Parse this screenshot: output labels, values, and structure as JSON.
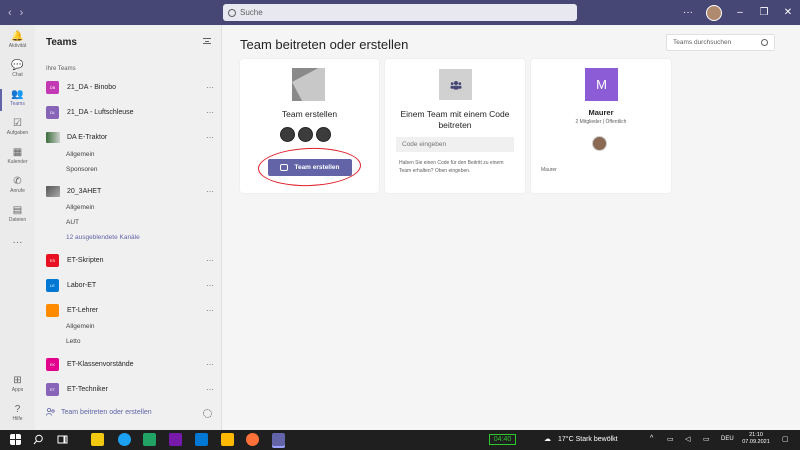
{
  "titlebar": {
    "back": "‹",
    "forward": "›",
    "search_placeholder": "Suche",
    "more": "···",
    "min": "–",
    "restore": "❐",
    "close": "✕"
  },
  "rail": [
    {
      "label": "Aktivität",
      "icon": "bell-icon",
      "glyph": "🔔"
    },
    {
      "label": "Chat",
      "icon": "chat-icon",
      "glyph": "💬"
    },
    {
      "label": "Teams",
      "icon": "teams-icon",
      "glyph": "👥"
    },
    {
      "label": "Aufgaben",
      "icon": "tasks-icon",
      "glyph": "☑"
    },
    {
      "label": "Kalender",
      "icon": "calendar-icon",
      "glyph": "▦"
    },
    {
      "label": "Anrufe",
      "icon": "phone-icon",
      "glyph": "✆"
    },
    {
      "label": "Dateien",
      "icon": "file-icon",
      "glyph": "▤"
    },
    {
      "label": "",
      "icon": "more-icon",
      "glyph": "···"
    },
    {
      "label": "Apps",
      "icon": "apps-icon",
      "glyph": "⊞"
    },
    {
      "label": "Hilfe",
      "icon": "help-icon",
      "glyph": "?"
    }
  ],
  "panel": {
    "title": "Teams",
    "group": "Ihre Teams",
    "teams": [
      {
        "tile": "DB",
        "color": "#c239b3",
        "name": "21_DA - Binobo"
      },
      {
        "tile": "DL",
        "color": "#8764b8",
        "name": "21_DA - Luftschleuse"
      },
      {
        "tile": "",
        "color": "",
        "name": "DA E-Traktor"
      },
      {
        "tile": "",
        "color": "",
        "name": "20_3AHET"
      },
      {
        "tile": "ES",
        "color": "#e81123",
        "name": "ET-Skripten"
      },
      {
        "tile": "LE",
        "color": "#0078d4",
        "name": "Labor-ET"
      },
      {
        "tile": "",
        "color": "#ff8c00",
        "name": "ET-Lehrer"
      },
      {
        "tile": "EK",
        "color": "#e3008c",
        "name": "ET-Klassenvorstände"
      },
      {
        "tile": "ET",
        "color": "#8764b8",
        "name": "ET-Techniker"
      }
    ],
    "channels": {
      "etraktor": [
        "Allgemein",
        "Sponsoren"
      ],
      "ahet": [
        "Allgemein",
        "AUT",
        "12 ausgeblendete Kanäle"
      ],
      "lehrer": [
        "Allgemein",
        "Letto"
      ]
    },
    "more": "···",
    "footer": "Team beitreten oder erstellen"
  },
  "main": {
    "title": "Team beitreten oder erstellen",
    "find_placeholder": "Teams durchsuchen",
    "create_card": {
      "title": "Team erstellen",
      "button": "Team erstellen"
    },
    "join_card": {
      "title_line1": "Einem Team mit einem Code",
      "title_line2": "beitreten",
      "input_placeholder": "Code eingeben",
      "help": "Haben Sie einen Code für den Beitritt zu einem Team erhalten? Oben eingeben."
    },
    "team_card": {
      "initial": "M",
      "name": "Maurer",
      "meta": "2 Mitglieder | Öffentlich",
      "footer": "Maurer"
    }
  },
  "taskbar": {
    "battery": "04:40",
    "weather": "17°C  Stark bewölkt",
    "lang": "DEU",
    "time": "21:10",
    "date": "07.09.2021"
  }
}
